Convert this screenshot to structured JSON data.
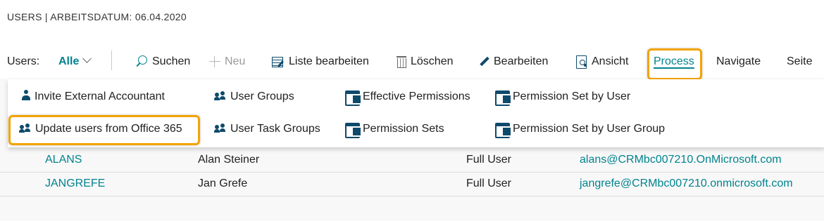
{
  "header": {
    "title": "USERS | ARBEITSDATUM: 06.04.2020"
  },
  "action_bar": {
    "label": "Users:",
    "filter": "Alle",
    "items": {
      "search": "Suchen",
      "new": "Neu",
      "edit_list": "Liste bearbeiten",
      "delete": "Löschen",
      "edit": "Bearbeiten",
      "view": "Ansicht"
    },
    "tabs": {
      "process": "Process",
      "navigate": "Navigate",
      "page": "Seite"
    }
  },
  "process_menu": {
    "col1": [
      "Invite External Accountant",
      "Update users from Office 365"
    ],
    "col2": [
      "User Groups",
      "User Task Groups"
    ],
    "col3": [
      "Effective Permissions",
      "Permission Sets"
    ],
    "col4": [
      "Permission Set by User",
      "Permission Set by User Group"
    ]
  },
  "table": {
    "rows": [
      {
        "user_name": "ALANS",
        "full_name": "Alan Steiner",
        "license": "Full User",
        "email": "alans@CRMbc007210.OnMicrosoft.com"
      },
      {
        "user_name": "JANGREFE",
        "full_name": "Jan Grefe",
        "license": "Full User",
        "email": "jangrefe@CRMbc007210.onmicrosoft.com"
      }
    ]
  },
  "colors": {
    "accent": "#00838f",
    "highlight": "#f4a300",
    "icon": "#0e4a6b"
  }
}
